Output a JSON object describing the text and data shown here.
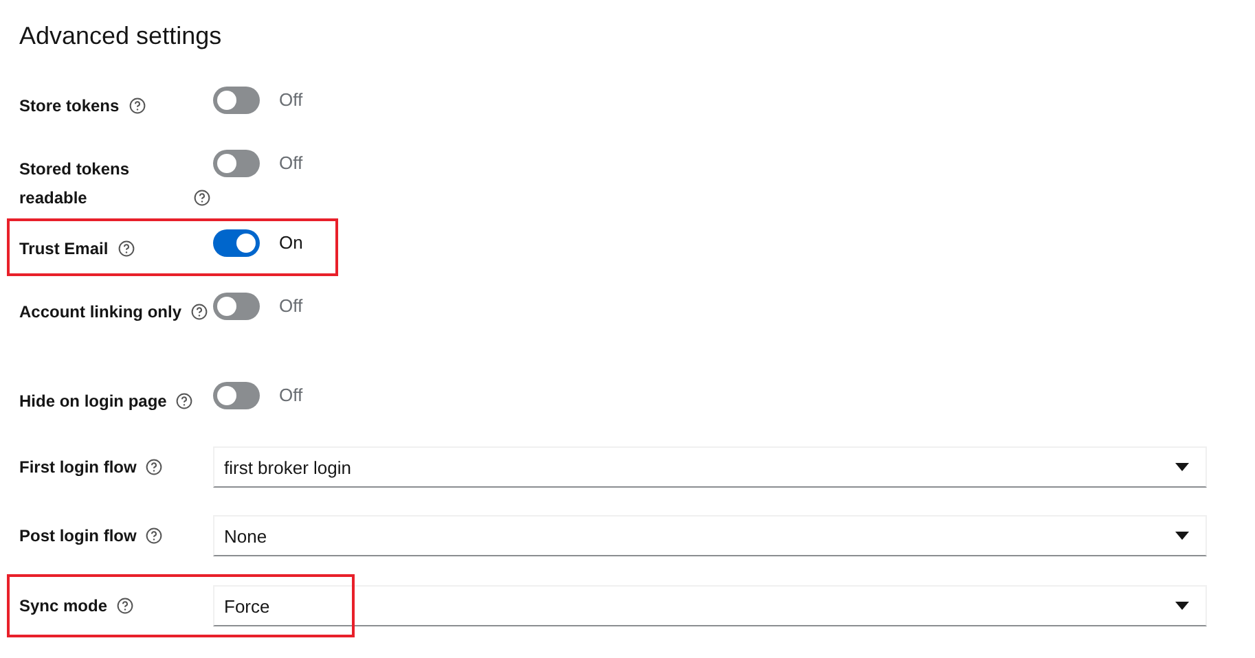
{
  "title": "Advanced settings",
  "fields": [
    {
      "kind": "switch",
      "label": "Store tokens",
      "on": false,
      "state_text": "Off",
      "highlighted": false
    },
    {
      "kind": "switch",
      "label": "Stored tokens readable",
      "on": false,
      "state_text": "Off",
      "highlighted": false
    },
    {
      "kind": "switch",
      "label": "Trust Email",
      "on": true,
      "state_text": "On",
      "highlighted": true
    },
    {
      "kind": "switch",
      "label": "Account linking only",
      "on": false,
      "state_text": "Off",
      "highlighted": false
    },
    {
      "kind": "switch",
      "label": "Hide on login page",
      "on": false,
      "state_text": "Off",
      "highlighted": false
    },
    {
      "kind": "select",
      "label": "First login flow",
      "value": "first broker login",
      "highlighted": false
    },
    {
      "kind": "select",
      "label": "Post login flow",
      "value": "None",
      "highlighted": false
    },
    {
      "kind": "select",
      "label": "Sync mode",
      "value": "Force",
      "highlighted": true
    }
  ]
}
